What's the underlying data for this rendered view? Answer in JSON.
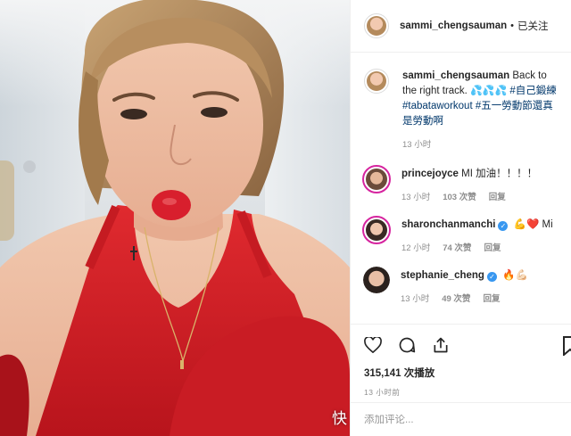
{
  "header": {
    "username": "sammi_chengsauman",
    "separator": "•",
    "follow_status": "已关注"
  },
  "caption": {
    "username": "sammi_chengsauman",
    "text_before": "Back to the right track.",
    "droplets": "💦💦💦",
    "tag1": "#自己鍛練",
    "tag2": "#tabataworkout",
    "tag3": "#五一勞動節還真是勞動啊",
    "time": "13 小时"
  },
  "comments": [
    {
      "username": "princejoyce",
      "verified": false,
      "text": "MI 加油！！！！",
      "time": "13 小时",
      "likes": "103 次赞",
      "reply": "回复"
    },
    {
      "username": "sharonchanmanchi",
      "verified": true,
      "text": "💪❤️ Mi",
      "time": "12 小时",
      "likes": "74 次赞",
      "reply": "回复"
    },
    {
      "username": "stephanie_cheng",
      "verified": true,
      "text": "🔥💪🏻",
      "time": "13 小时",
      "likes": "49 次赞",
      "reply": "回复"
    }
  ],
  "post": {
    "views": "315,141 次播放",
    "time_ago": "13 小时前"
  },
  "comment_box": {
    "placeholder": "添加评论..."
  },
  "watermark": "快",
  "colors": {
    "accent_blue": "#3897f0",
    "hashtag": "#00376b",
    "muted": "#8e8e8e",
    "lipstick": "#d81f2d",
    "top_red": "#d7232b"
  },
  "icons": [
    "heart-icon",
    "comment-icon",
    "share-icon",
    "bookmark-icon",
    "verified-icon"
  ]
}
